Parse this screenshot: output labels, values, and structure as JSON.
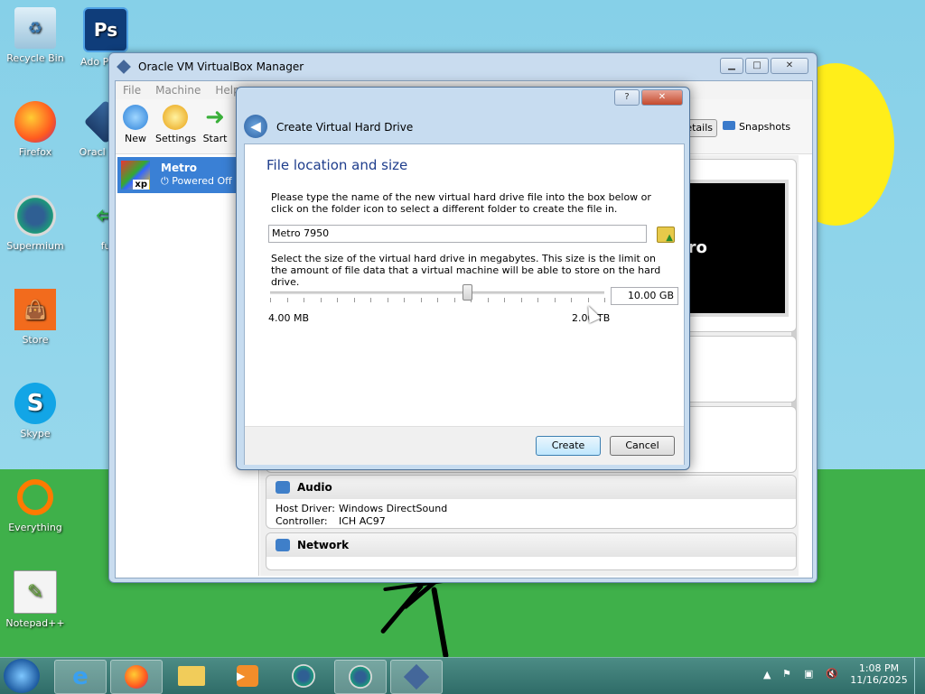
{
  "desktop": {
    "icons": [
      {
        "label": "Recycle Bin"
      },
      {
        "label": "Adobe Photoshop",
        "short": "Ado Photo"
      },
      {
        "label": "Firefox"
      },
      {
        "label": "Oracle VirtualBox",
        "short": "Oracl Virtu"
      },
      {
        "label": "Supermium"
      },
      {
        "label": "fu"
      },
      {
        "label": "Store"
      },
      {
        "label": "Skype"
      },
      {
        "label": "Everything"
      },
      {
        "label": "Notepad++"
      }
    ]
  },
  "vbox": {
    "title": "Oracle VM VirtualBox Manager",
    "menu": [
      "File",
      "Machine",
      "Help"
    ],
    "toolbar": {
      "new": "New",
      "settings": "Settings",
      "start": "Start"
    },
    "right_tabs": {
      "details": "Details",
      "snapshots": "Snapshots"
    },
    "vm": {
      "name": "Metro",
      "state": "Powered Off",
      "badge": "xp",
      "preview_text": "tro"
    },
    "audio": {
      "header": "Audio",
      "host_driver_label": "Host Driver:",
      "host_driver": "Windows DirectSound",
      "controller_label": "Controller:",
      "controller": "ICH AC97"
    },
    "network": {
      "header": "Network"
    }
  },
  "dialog": {
    "title": "Create Virtual Hard Drive",
    "heading": "File location and size",
    "desc1": "Please type the name of the new virtual hard drive file into the box below or click on the folder icon to select a different folder to create the file in.",
    "file_name": "Metro 7950",
    "desc2": "Select the size of the virtual hard drive in megabytes. This size is the limit on the amount of file data that a virtual machine will be able to store on the hard drive.",
    "size_value": "10.00 GB",
    "min_label": "4.00 MB",
    "max_label": "2.00 TB",
    "slider_fraction": 0.59,
    "create_label": "Create",
    "cancel_label": "Cancel",
    "help_icon": "?",
    "close_icon": "✕"
  },
  "taskbar": {
    "time": "1:08 PM",
    "date": "11/16/2025"
  }
}
